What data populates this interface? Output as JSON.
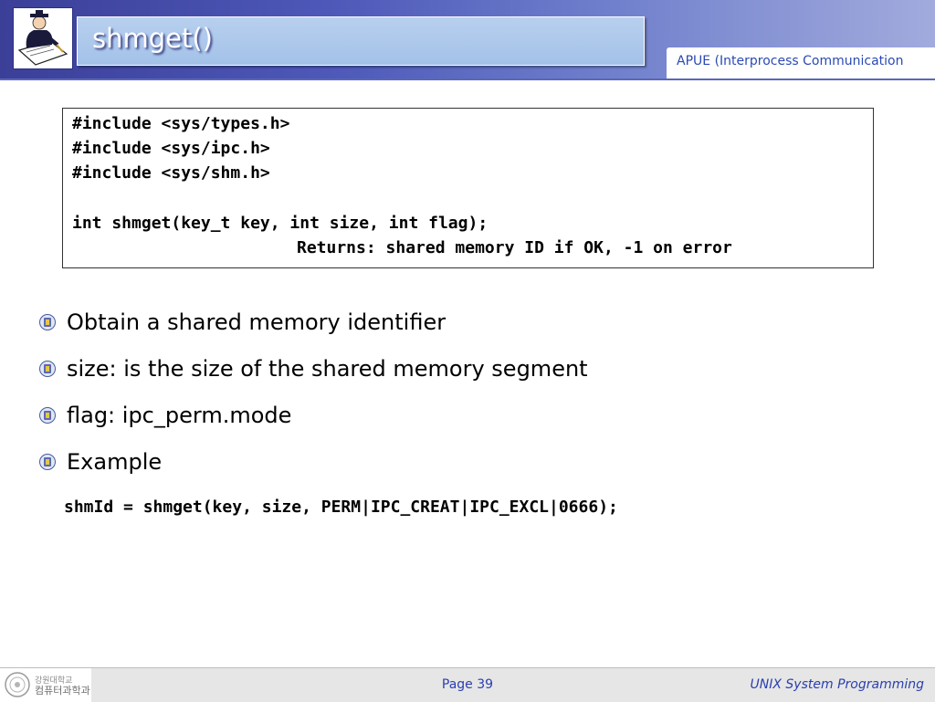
{
  "header": {
    "title": "shmget()",
    "subject": "APUE (Interprocess Communication"
  },
  "code_block": {
    "lines": [
      "#include <sys/types.h>",
      "#include <sys/ipc.h>",
      "#include <sys/shm.h>",
      "",
      "int shmget(key_t key, int size, int flag);"
    ],
    "returns": "Returns: shared memory ID if OK, -1 on error"
  },
  "bullets": [
    "Obtain a shared memory identifier",
    "size: is the size of the shared memory segment",
    "flag: ipc_perm.mode",
    "Example"
  ],
  "example_code": "shmId = shmget(key, size, PERM|IPC_CREAT|IPC_EXCL|0666);",
  "footer": {
    "logo_line1": "강원대학교",
    "logo_line2": "컴퓨터과학과",
    "page": "Page 39",
    "course": "UNIX System Programming"
  },
  "icons": {
    "header_logo": "scholar-writing-icon",
    "bullet": "bullet-emblem-icon",
    "footer_logo": "university-seal-icon"
  },
  "colors": {
    "header_start": "#3b3f98",
    "header_end": "#a2abdd",
    "title_bar": "#a3c1e8",
    "accent_blue": "#2a3fb0",
    "footer_bg": "#e6e6e6"
  }
}
